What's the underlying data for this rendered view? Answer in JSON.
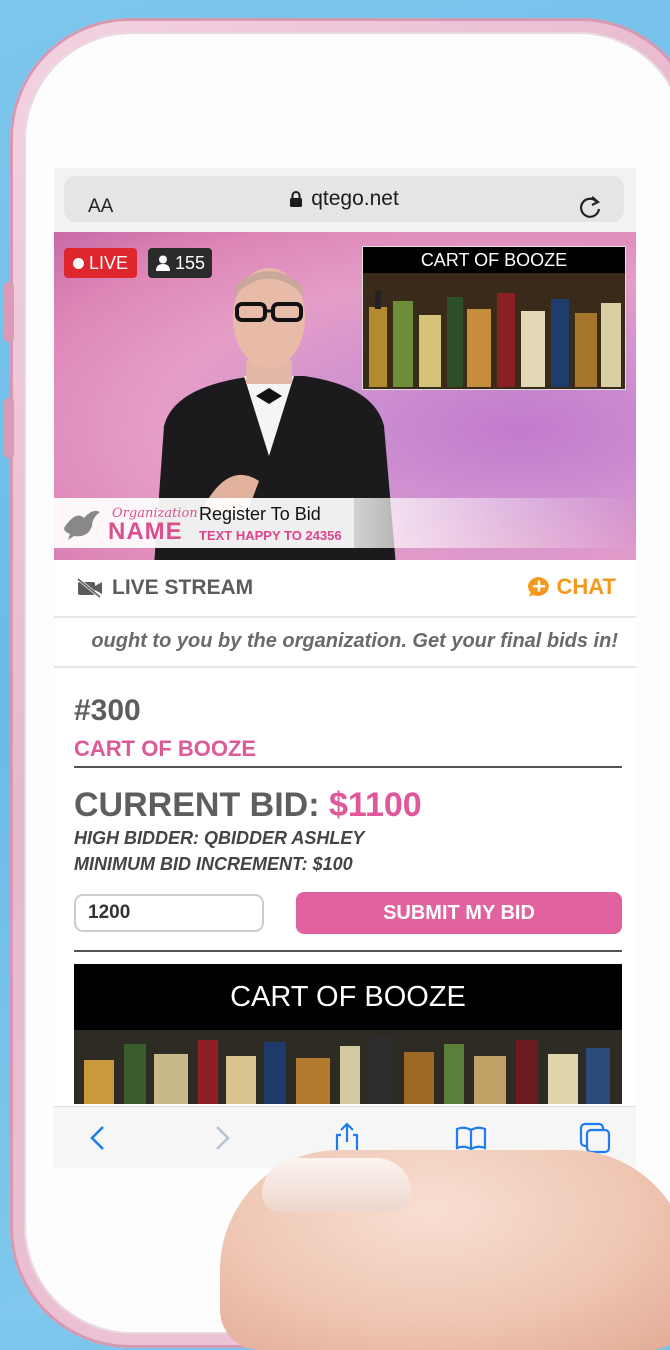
{
  "browser": {
    "text_size_label": "AA",
    "url": "qtego.net"
  },
  "video": {
    "live_label": "LIVE",
    "viewer_count": "155",
    "pip_title": "CART OF BOOZE",
    "org_small": "Organization",
    "org_big": "NAME",
    "register_title": "Register To Bid",
    "register_sub": "TEXT HAPPY TO 24356"
  },
  "tabs": {
    "live_stream": "LIVE STREAM",
    "chat": "CHAT"
  },
  "ticker": "ought to you by the organization. Get your final bids in!",
  "item": {
    "number": "#300",
    "name": "CART OF BOOZE",
    "current_bid_label": "CURRENT BID:",
    "current_bid_value": "$1100",
    "high_bidder": "HIGH BIDDER: QBIDDER ASHLEY",
    "min_increment": "MINIMUM BID INCREMENT: $100",
    "bid_input_value": "1200",
    "submit_label": "SUBMIT MY BID",
    "banner_title": "CART OF BOOZE"
  },
  "colors": {
    "accent_pink": "#e0579a",
    "live_red": "#e0262d",
    "chat_orange": "#f39a1e",
    "ios_blue": "#1f7cf2"
  },
  "icons": [
    "lock-icon",
    "reload-icon",
    "user-icon",
    "video-off-icon",
    "chat-bubble-icon",
    "back-icon",
    "forward-icon",
    "share-icon",
    "bookmarks-icon",
    "tabs-icon"
  ]
}
